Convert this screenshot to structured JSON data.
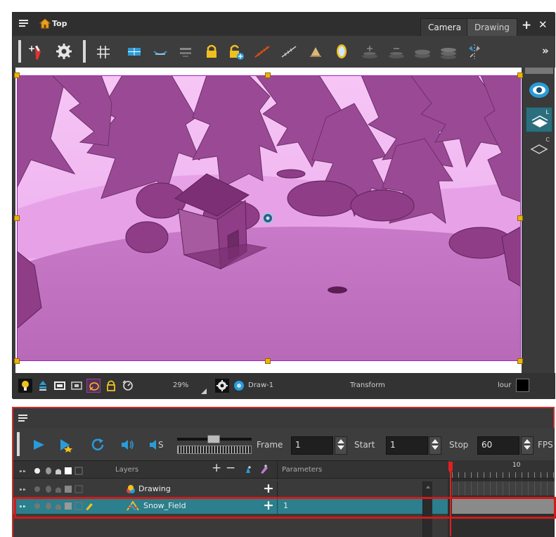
{
  "camera_window": {
    "title": "Top",
    "tabs": [
      {
        "label": "Camera",
        "active": true
      },
      {
        "label": "Drawing",
        "active": false
      }
    ],
    "toolbar_icons": [
      "animate-mode-icon",
      "settings-gear-icon",
      "grid-icon",
      "field-guide-icon",
      "onion-skin-icon",
      "light-table-icon",
      "lock-icon",
      "lock-add-icon",
      "easy-flipping-icon",
      "onion-skin-range-icon",
      "shade-icon",
      "mirror-icon",
      "layer-stack-1-icon",
      "layer-stack-2-icon",
      "layer-stack-3-icon",
      "layer-stack-4-icon",
      "symmetry-icon",
      "more-icon"
    ],
    "more_glyph": "»",
    "side_strip": {
      "line_label": "L",
      "colour_label": "C"
    },
    "status_bar": {
      "zoom": "29%",
      "drawing": "Draw-1",
      "tool": "Transform",
      "colour_label": "lour",
      "colour_value": "#000000"
    }
  },
  "timeline": {
    "playback": {
      "frame_label": "Frame",
      "frame_value": "1",
      "start_label": "Start",
      "start_value": "1",
      "stop_label": "Stop",
      "stop_value": "60",
      "fps_label": "FPS",
      "sound_label": "S"
    },
    "header": {
      "layers_label": "Layers",
      "parameters_label": "Parameters",
      "frame_tick": "10"
    },
    "layers": [
      {
        "name": "Drawing",
        "parameter": "",
        "selected": false
      },
      {
        "name": "Snow_Field",
        "parameter": "1",
        "selected": true
      }
    ]
  },
  "colors": {
    "selection": "#2c7f8c",
    "highlight_box": "#d11a1a",
    "stage_tint": "#f2b6f2",
    "stage_dark": "#8a3a7a"
  }
}
